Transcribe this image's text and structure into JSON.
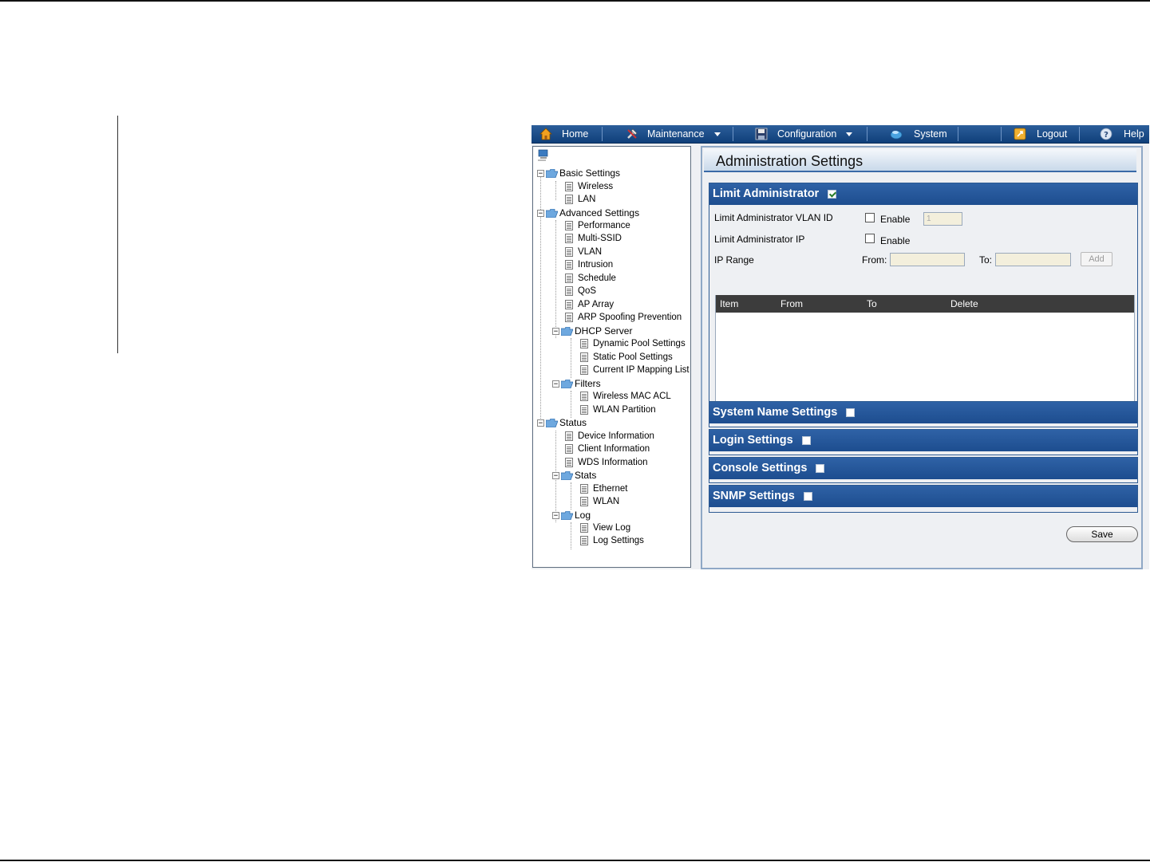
{
  "nav": {
    "home": "Home",
    "maintenance": "Maintenance",
    "configuration": "Configuration",
    "system": "System",
    "logout": "Logout",
    "help": "Help",
    "icons": {
      "home": "home-icon",
      "maintenance": "tools-icon",
      "configuration": "floppy-disk-icon",
      "system": "system-icon",
      "logout": "logout-icon",
      "help": "help-icon"
    }
  },
  "tree": {
    "basic_settings": "Basic Settings",
    "wireless": "Wireless",
    "lan": "LAN",
    "advanced_settings": "Advanced Settings",
    "performance": "Performance",
    "multi_ssid": "Multi-SSID",
    "vlan": "VLAN",
    "intrusion": "Intrusion",
    "schedule": "Schedule",
    "qos": "QoS",
    "ap_array": "AP Array",
    "arp_spoofing": "ARP Spoofing Prevention",
    "dhcp_server": "DHCP Server",
    "dynamic_pool": "Dynamic Pool Settings",
    "static_pool": "Static Pool Settings",
    "current_ip": "Current IP Mapping List",
    "filters": "Filters",
    "wireless_mac_acl": "Wireless MAC ACL",
    "wlan_partition": "WLAN Partition",
    "status": "Status",
    "device_info": "Device Information",
    "client_info": "Client Information",
    "wds_info": "WDS Information",
    "stats": "Stats",
    "ethernet": "Ethernet",
    "wlan": "WLAN",
    "log": "Log",
    "view_log": "View Log",
    "log_settings": "Log Settings"
  },
  "main": {
    "title": "Administration Settings",
    "limit_admin": {
      "title": "Limit Administrator",
      "checked": true,
      "vlan_id_label": "Limit Administrator VLAN ID",
      "enable_label": "Enable",
      "vlan_value": "1",
      "ip_label": "Limit Administrator IP",
      "ip_enable_label": "Enable",
      "ip_range_label": "IP Range",
      "from_label": "From:",
      "to_label": "To:",
      "add_label": "Add",
      "table_headers": [
        "Item",
        "From",
        "To",
        "Delete"
      ]
    },
    "system_name": "System Name Settings",
    "login": "Login Settings",
    "console": "Console Settings",
    "snmp": "SNMP Settings",
    "save_label": "Save"
  }
}
